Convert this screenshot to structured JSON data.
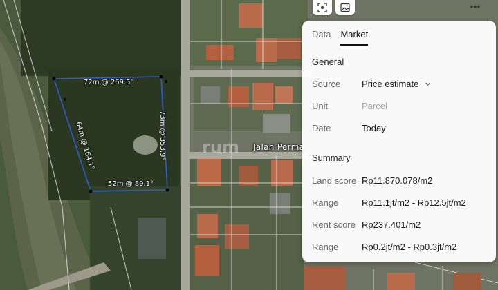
{
  "map": {
    "dimensions": [
      "72m @ 269.5°",
      "73m @ 353.9°",
      "64m @ 164.1°",
      "52m @ 89.1°"
    ],
    "street_label": "Jalan Perma",
    "watermark": "rum"
  },
  "toolbar": {
    "scan_icon": "scan-icon",
    "image_icon": "image-icon",
    "more_icon": "more-icon"
  },
  "panel": {
    "tabs": [
      {
        "label": "Data",
        "active": false
      },
      {
        "label": "Market",
        "active": true
      }
    ],
    "general": {
      "title": "General",
      "source_label": "Source",
      "source_value": "Price estimate",
      "unit_label": "Unit",
      "unit_placeholder": "Parcel",
      "date_label": "Date",
      "date_value": "Today"
    },
    "summary": {
      "title": "Summary",
      "land_score_label": "Land score",
      "land_score_value": "Rp11.870.078/m2",
      "land_range_label": "Range",
      "land_range_value": "Rp11.1jt/m2 - Rp12.5jt/m2",
      "rent_score_label": "Rent score",
      "rent_score_value": "Rp237.401/m2",
      "rent_range_label": "Range",
      "rent_range_value": "Rp0.2jt/m2 - Rp0.3jt/m2"
    }
  },
  "colors": {
    "parcel_outline": "#2f5fd8",
    "active_tab": "#111111"
  }
}
